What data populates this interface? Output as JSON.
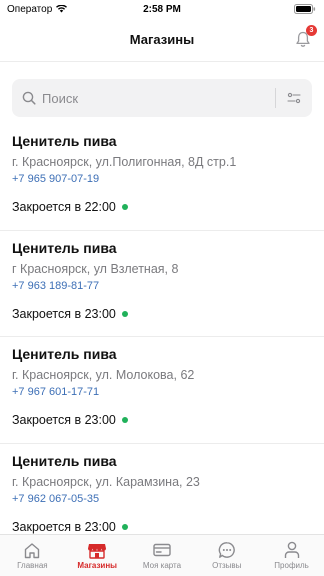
{
  "status_bar": {
    "carrier": "Оператор",
    "time": "2:58 PM"
  },
  "header": {
    "title": "Магазины",
    "notifications_count": "3"
  },
  "search": {
    "placeholder": "Поиск",
    "value": ""
  },
  "stores": [
    {
      "name": "Ценитель пива",
      "address": "г. Красноярск, ул.Полигонная, 8Д стр.1",
      "phone": "+7 965 907-07-19",
      "hours": "Закроется в 22:00"
    },
    {
      "name": "Ценитель пива",
      "address": "г Красноярск, ул Взлетная, 8",
      "phone": "+7 963 189-81-77",
      "hours": "Закроется в 23:00"
    },
    {
      "name": "Ценитель пива",
      "address": "г. Красноярск, ул. Молокова, 62",
      "phone": "+7 967 601-17-71",
      "hours": "Закроется в 23:00"
    },
    {
      "name": "Ценитель пива",
      "address": "г. Красноярск, ул. Карамзина, 23",
      "phone": "+7 962 067-05-35",
      "hours": "Закроется в 23:00"
    }
  ],
  "tabs": [
    {
      "label": "Главная",
      "icon": "home-icon",
      "active": false
    },
    {
      "label": "Магазины",
      "icon": "shop-icon",
      "active": true
    },
    {
      "label": "Моя карта",
      "icon": "card-icon",
      "active": false
    },
    {
      "label": "Отзывы",
      "icon": "chat-icon",
      "active": false
    },
    {
      "label": "Профиль",
      "icon": "profile-icon",
      "active": false
    }
  ],
  "colors": {
    "accent": "#d62a2a",
    "link": "#3d6fb6",
    "open_status": "#20b15a",
    "badge": "#e53935"
  }
}
